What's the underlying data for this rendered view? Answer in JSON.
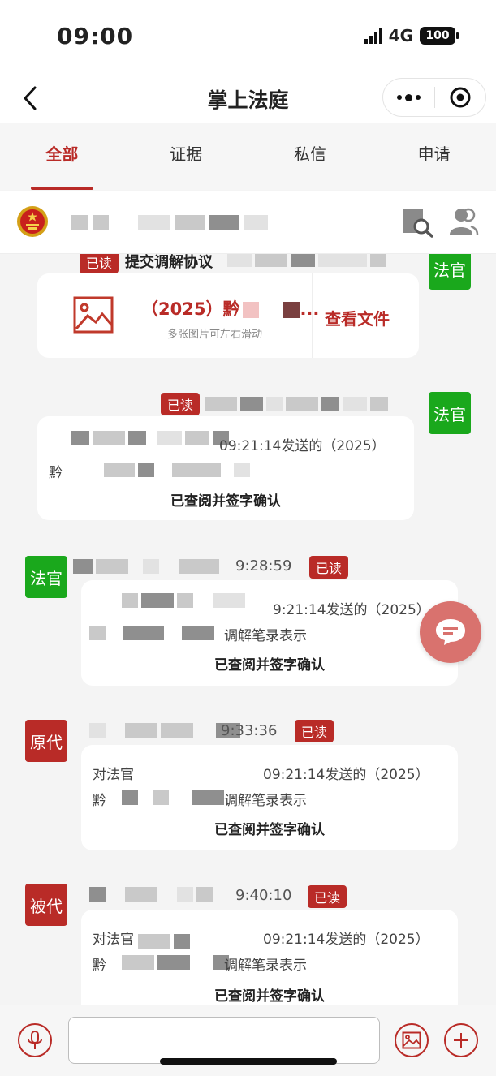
{
  "status_bar": {
    "time": "09:00",
    "network": "4G",
    "battery": "100"
  },
  "nav": {
    "title": "掌上法庭"
  },
  "tabs": [
    {
      "label": "全部",
      "active": true
    },
    {
      "label": "证据",
      "active": false
    },
    {
      "label": "私信",
      "active": false
    },
    {
      "label": "申请",
      "active": false
    }
  ],
  "messages": [
    {
      "role": "法官",
      "read": "已读",
      "title": "提交调解协议",
      "file": {
        "title": "（2025）黔",
        "subtitle": "多张图片可左右滑动",
        "view_label": "查看文件"
      }
    },
    {
      "role": "法官",
      "read": "已读",
      "line1": "09:21:14发送的（2025）",
      "line2": "黔",
      "confirm": "已查阅并签字确认"
    },
    {
      "role": "法官",
      "read": "已读",
      "time": "9:28:59",
      "line1": "9:21:14发送的（2025）",
      "line2": "调解笔录表示",
      "confirm": "已查阅并签字确认"
    },
    {
      "role": "原代",
      "read": "已读",
      "time": "9:33:36",
      "line1a": "对法官",
      "line1": "09:21:14发送的（2025）",
      "line2a": "黔",
      "line2": "调解笔录表示",
      "confirm": "已查阅并签字确认"
    },
    {
      "role": "被代",
      "read": "已读",
      "time": "9:40:10",
      "line1a": "对法官",
      "line1": "09:21:14发送的（2025）",
      "line2a": "黔",
      "line2": "调解笔录表示",
      "confirm": "已查阅并签字确认"
    }
  ],
  "input": {
    "placeholder": ""
  },
  "colors": {
    "accent": "#b92b27",
    "judge": "#1aa81c",
    "float": "#d9726e"
  },
  "icons": [
    "back-arrow-icon",
    "more-icon",
    "target-icon",
    "court-emblem-icon",
    "search-file-icon",
    "users-icon",
    "image-icon",
    "chat-bubble-icon",
    "microphone-icon",
    "plus-icon"
  ]
}
